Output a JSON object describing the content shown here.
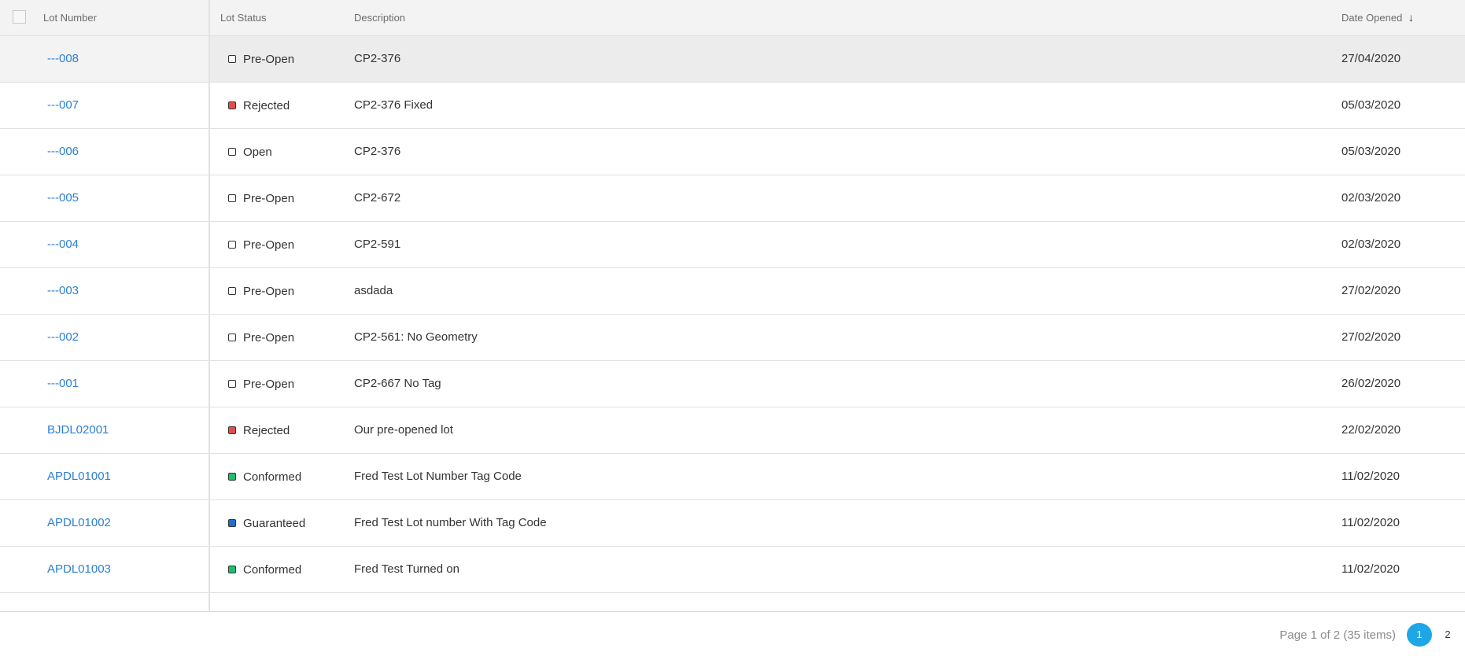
{
  "grid": {
    "columns": {
      "lot_number": "Lot Number",
      "lot_status": "Lot Status",
      "description": "Description",
      "date_opened": "Date Opened",
      "sort_indicator": "↓"
    },
    "rows": [
      {
        "lot": "---008",
        "status": "Pre-Open",
        "status_color": "#ffffff",
        "description": "CP2-376",
        "date": "27/04/2020",
        "selected": true
      },
      {
        "lot": "---007",
        "status": "Rejected",
        "status_color": "#e84b4b",
        "description": "CP2-376 Fixed",
        "date": "05/03/2020"
      },
      {
        "lot": "---006",
        "status": "Open",
        "status_color": "#ffffff",
        "description": "CP2-376",
        "date": "05/03/2020"
      },
      {
        "lot": "---005",
        "status": "Pre-Open",
        "status_color": "#ffffff",
        "description": "CP2-672",
        "date": "02/03/2020"
      },
      {
        "lot": "---004",
        "status": "Pre-Open",
        "status_color": "#ffffff",
        "description": "CP2-591",
        "date": "02/03/2020"
      },
      {
        "lot": "---003",
        "status": "Pre-Open",
        "status_color": "#ffffff",
        "description": "asdada",
        "date": "27/02/2020"
      },
      {
        "lot": "---002",
        "status": "Pre-Open",
        "status_color": "#ffffff",
        "description": "CP2-561: No Geometry",
        "date": "27/02/2020"
      },
      {
        "lot": "---001",
        "status": "Pre-Open",
        "status_color": "#ffffff",
        "description": "CP2-667 No Tag",
        "date": "26/02/2020"
      },
      {
        "lot": "BJDL02001",
        "status": "Rejected",
        "status_color": "#e84b4b",
        "description": "Our pre-opened lot",
        "date": "22/02/2020"
      },
      {
        "lot": "APDL01001",
        "status": "Conformed",
        "status_color": "#1dbf6e",
        "description": "Fred Test Lot Number Tag Code",
        "date": "11/02/2020"
      },
      {
        "lot": "APDL01002",
        "status": "Guaranteed",
        "status_color": "#1d6fd0",
        "description": "Fred Test Lot number With Tag Code",
        "date": "11/02/2020"
      },
      {
        "lot": "APDL01003",
        "status": "Conformed",
        "status_color": "#1dbf6e",
        "description": "Fred Test Turned on",
        "date": "11/02/2020"
      }
    ]
  },
  "pager": {
    "info": "Page 1 of 2 (35 items)",
    "pages": [
      "1",
      "2"
    ],
    "current": "1",
    "accent": "#1fa6e6"
  },
  "colors": {
    "link": "#2a7fd4",
    "header_bg": "#f3f3f3",
    "selected_row_bg": "#ececec"
  }
}
